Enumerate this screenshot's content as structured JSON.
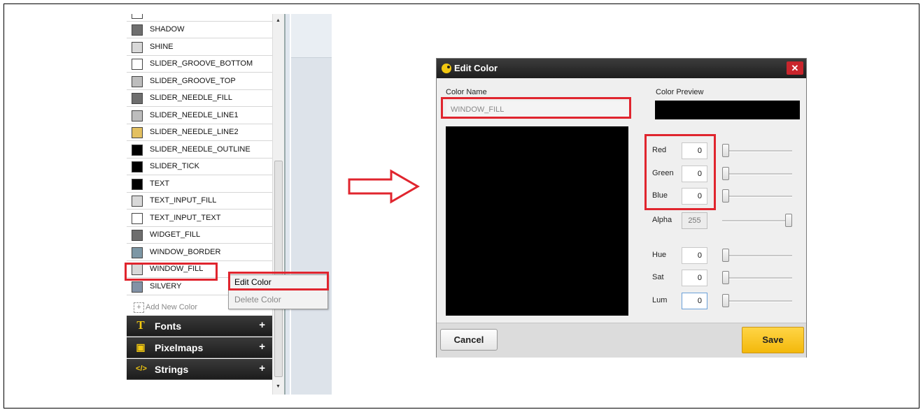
{
  "colors_panel": {
    "items": [
      {
        "label": "SHADOW",
        "color": "#6e6e6e"
      },
      {
        "label": "SHINE",
        "color": "#d8d8d8"
      },
      {
        "label": "SLIDER_GROOVE_BOTTOM",
        "color": "#ffffff"
      },
      {
        "label": "SLIDER_GROOVE_TOP",
        "color": "#bdbdbd"
      },
      {
        "label": "SLIDER_NEEDLE_FILL",
        "color": "#6e6e6e"
      },
      {
        "label": "SLIDER_NEEDLE_LINE1",
        "color": "#bdbdbd"
      },
      {
        "label": "SLIDER_NEEDLE_LINE2",
        "color": "#e3c060"
      },
      {
        "label": "SLIDER_NEEDLE_OUTLINE",
        "color": "#000000"
      },
      {
        "label": "SLIDER_TICK",
        "color": "#000000"
      },
      {
        "label": "TEXT",
        "color": "#000000"
      },
      {
        "label": "TEXT_INPUT_FILL",
        "color": "#d8d8d8"
      },
      {
        "label": "TEXT_INPUT_TEXT",
        "color": "#ffffff"
      },
      {
        "label": "WIDGET_FILL",
        "color": "#6e6e6e"
      },
      {
        "label": "WINDOW_BORDER",
        "color": "#7d97a5"
      },
      {
        "label": "WINDOW_FILL",
        "color": "#d8d8d8"
      },
      {
        "label": "SILVERY",
        "color": "#8292a6"
      }
    ],
    "add_new_label": "Add New Color",
    "sections": [
      {
        "label": "Fonts",
        "icon": "font-icon",
        "plus": "+"
      },
      {
        "label": "Pixelmaps",
        "icon": "image-icon",
        "plus": "+"
      },
      {
        "label": "Strings",
        "icon": "code-icon",
        "plus": "+"
      }
    ],
    "section_icons": {
      "fonts": "T",
      "pixelmaps": "▣",
      "strings": "</>"
    }
  },
  "context_menu": {
    "edit": "Edit Color",
    "delete": "Delete Color"
  },
  "dialog": {
    "title": "Edit Color",
    "close": "✕",
    "color_name_label": "Color Name",
    "color_name_value": "WINDOW_FILL",
    "color_preview_label": "Color Preview",
    "preview_color": "#000000",
    "channels": [
      {
        "label": "Red",
        "value": "0",
        "level": 0
      },
      {
        "label": "Green",
        "value": "0",
        "level": 0
      },
      {
        "label": "Blue",
        "value": "0",
        "level": 0
      },
      {
        "label": "Alpha",
        "value": "255",
        "level": 1
      },
      {
        "label": "Hue",
        "value": "0",
        "level": 0
      },
      {
        "label": "Sat",
        "value": "0",
        "level": 0
      },
      {
        "label": "Lum",
        "value": "0",
        "level": 0
      }
    ],
    "cancel": "Cancel",
    "save": "Save"
  },
  "accent_colors": {
    "highlight_box": "#e0252e",
    "save_button": "#f6c21c",
    "titlebar": "#2a2a2a"
  }
}
